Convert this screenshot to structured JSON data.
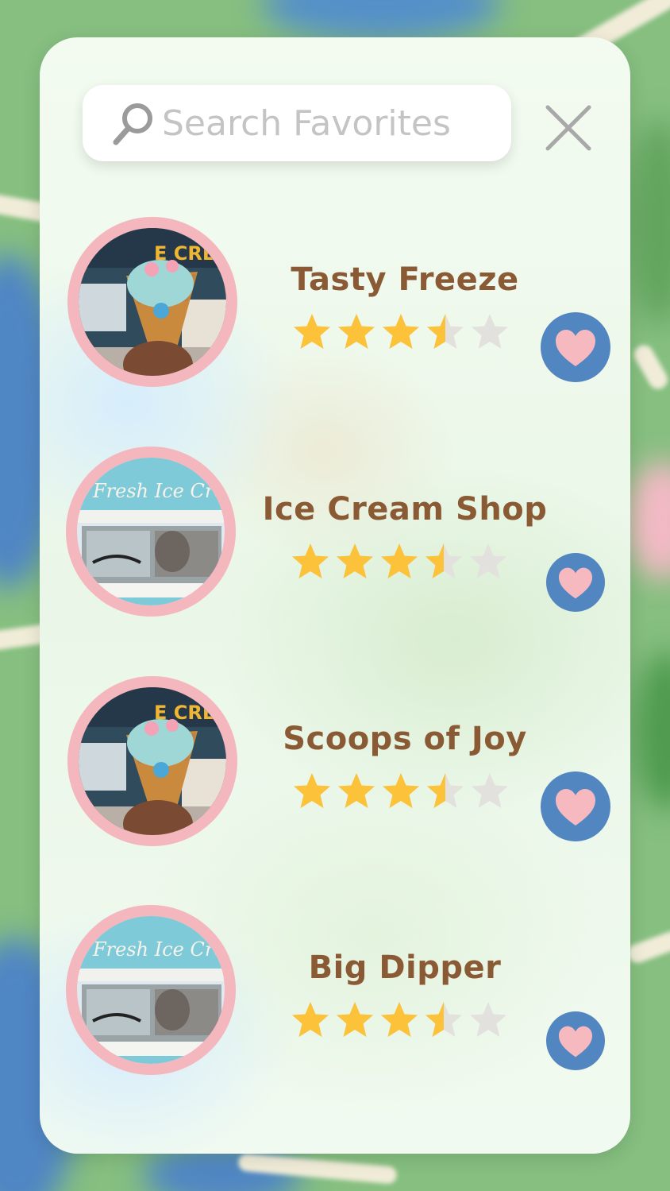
{
  "search": {
    "placeholder": "Search Favorites"
  },
  "colors": {
    "panel": "#eef8ec",
    "title": "#8a5a34",
    "star_filled": "#fbc23a",
    "star_empty": "#e3e1dd",
    "heart_button": "#5286c1",
    "heart": "#f6b9c0",
    "avatar_ring": "#f4b7bd"
  },
  "favorites": [
    {
      "name": "Tasty Freeze",
      "rating": 3.5,
      "image": "ice-cream-cone-photo"
    },
    {
      "name": "Ice Cream Shop",
      "rating": 3.5,
      "image": "ice-cream-truck-photo"
    },
    {
      "name": "Scoops of Joy",
      "rating": 3.5,
      "image": "ice-cream-cone-photo"
    },
    {
      "name": "Big Dipper",
      "rating": 3.5,
      "image": "ice-cream-truck-photo"
    }
  ],
  "rating_max": 5
}
